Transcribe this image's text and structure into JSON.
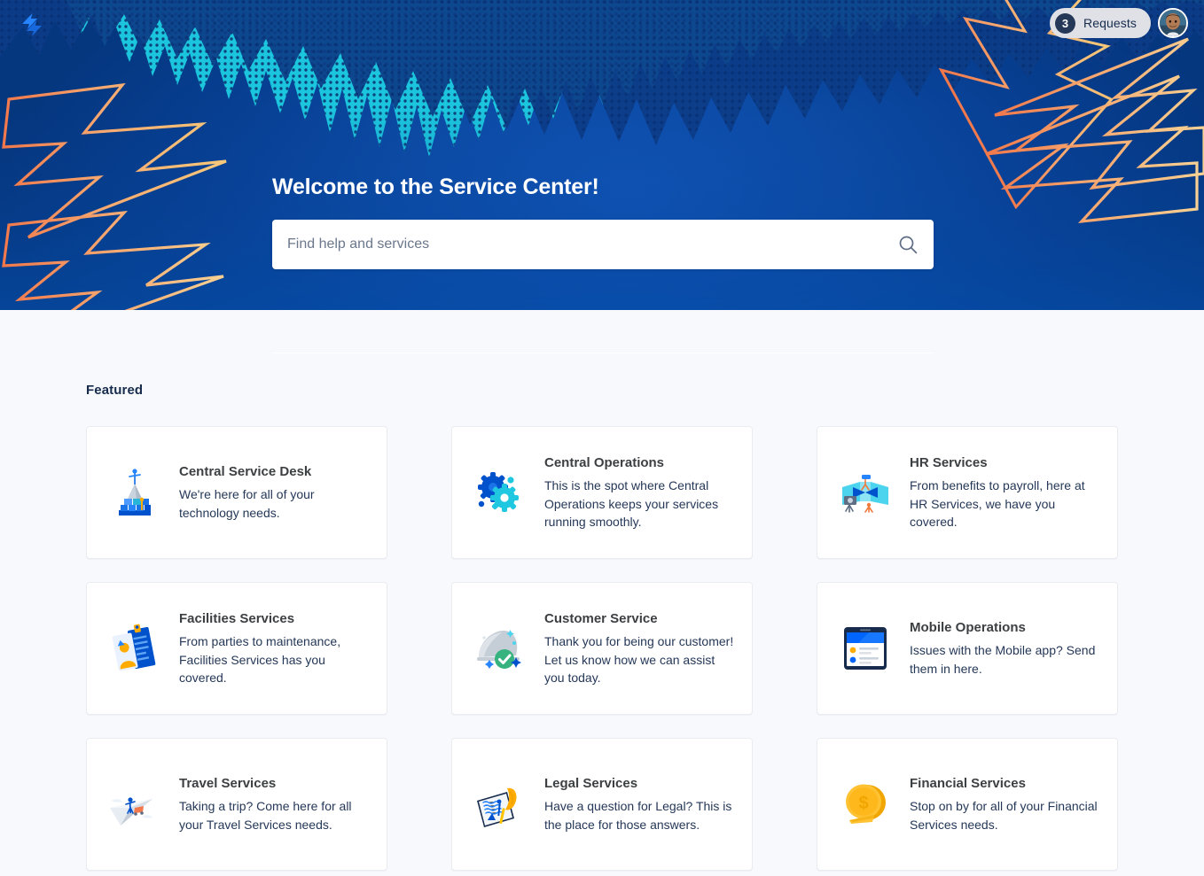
{
  "brand": {
    "logo_icon": "lightning-bolt-logo",
    "accent_blue": "#0052CC",
    "hero_blue": "#0550AE",
    "hero_dark_blue": "#05377F",
    "cyan": "#1FC8E0",
    "bolt_orange": "#F79B6B",
    "bolt_yellow": "#F5C26B",
    "page_background": "#F7F9FC",
    "text_navy": "#172B4D"
  },
  "topbar": {
    "requests": {
      "count": "3",
      "label": "Requests"
    },
    "avatar_name": "user-avatar"
  },
  "hero": {
    "title": "Welcome to the Service Center!",
    "search": {
      "value": "",
      "placeholder": "Find help and services",
      "icon": "search-icon"
    }
  },
  "featured": {
    "heading": "Featured",
    "cards": [
      {
        "title": "Central Service Desk",
        "description": "We're here for all of your technology needs.",
        "icon": "person-on-mountain-icon"
      },
      {
        "title": "Central Operations",
        "description": "This is the spot where Central Operations keeps your services running smoothly.",
        "icon": "gears-icon"
      },
      {
        "title": "HR Services",
        "description": "From benefits to payroll, here at HR Services, we have you covered.",
        "icon": "people-panels-icon"
      },
      {
        "title": "Facilities Services",
        "description": "From parties to maintenance, Facilities Services has you covered.",
        "icon": "id-badge-icon"
      },
      {
        "title": "Customer Service",
        "description": "Thank you for being our customer! Let us know how we can assist you today.",
        "icon": "service-dome-check-icon"
      },
      {
        "title": "Mobile Operations",
        "description": "Issues with the Mobile app? Send them in here.",
        "icon": "tablet-device-icon"
      },
      {
        "title": "Travel Services",
        "description": "Taking a trip? Come here for all your Travel Services needs.",
        "icon": "paper-plane-traveler-icon"
      },
      {
        "title": "Legal Services",
        "description": "Have a question for Legal? This is the place for those answers.",
        "icon": "document-quill-icon"
      },
      {
        "title": "Financial Services",
        "description": "Stop on by for all of your Financial Services needs.",
        "icon": "gold-coin-icon"
      }
    ]
  }
}
